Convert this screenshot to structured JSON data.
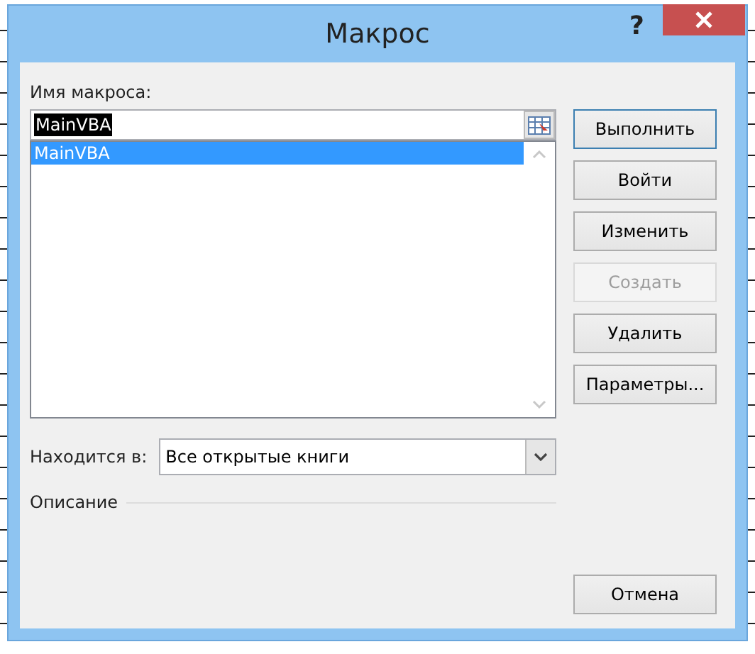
{
  "window": {
    "title": "Макрос",
    "help": "?"
  },
  "macro_name": {
    "label": "Имя макроса:",
    "value": "MainVBA",
    "text_selected": true
  },
  "macros": [
    {
      "name": "MainVBA",
      "selected": true
    }
  ],
  "buttons": [
    {
      "label": "Выполнить",
      "disabled": false,
      "default": true
    },
    {
      "label": "Войти",
      "disabled": false,
      "default": false
    },
    {
      "label": "Изменить",
      "disabled": false,
      "default": false
    },
    {
      "label": "Создать",
      "disabled": true,
      "default": false
    },
    {
      "label": "Удалить",
      "disabled": false,
      "default": false
    },
    {
      "label": "Параметры...",
      "disabled": false,
      "default": false
    }
  ],
  "location": {
    "label": "Находится в:",
    "value": "Все открытые книги"
  },
  "description": {
    "label": "Описание"
  },
  "cancel": "Отмена"
}
